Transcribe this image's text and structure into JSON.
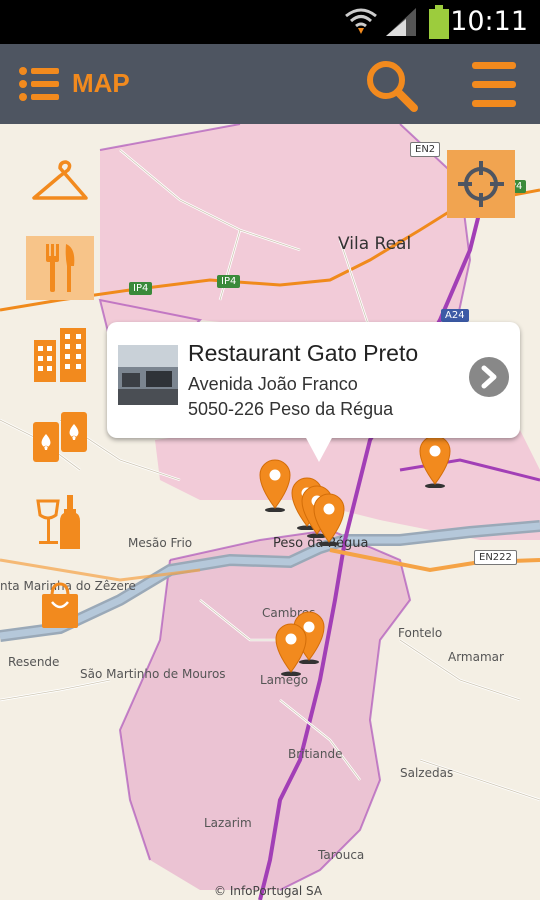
{
  "status_bar": {
    "time": "10:11"
  },
  "app_bar": {
    "title": "MAP"
  },
  "map": {
    "labels": {
      "vila_real": "Vila Real",
      "peso_da_regua": "Peso da Régua",
      "mesao_frio": "Mesão Frio",
      "santa_marinha_do_zezere": "nta Marinha do Zêzere",
      "resende": "Resende",
      "sao_martinho_de_mouros": "São Martinho de Mouros",
      "cambres": "Cambres",
      "lamego": "Lamego",
      "britiande": "Britiande",
      "salzedas": "Salzedas",
      "fontelo": "Fontelo",
      "armamar": "Armamar",
      "lazarim": "Lazarim",
      "tarouca": "Tarouca"
    },
    "roads": {
      "en2": "EN2",
      "ip4_a": "IP4",
      "ip4_b": "IP4",
      "ip4_c": "IP4",
      "a24": "A24",
      "en222": "EN222"
    },
    "copyright": "© InfoPortugal SA"
  },
  "categories": [
    {
      "icon": "hanger-icon"
    },
    {
      "icon": "fork-knife-icon",
      "active": true
    },
    {
      "icon": "building-icon"
    },
    {
      "icon": "cards-icon"
    },
    {
      "icon": "wine-icon"
    },
    {
      "icon": "shopping-bag-icon"
    }
  ],
  "popup": {
    "name": "Restaurant Gato Preto",
    "address": "Avenida João Franco",
    "postal": "5050-226 Peso da Régua"
  },
  "colors": {
    "accent": "#f28a1e",
    "appbar": "#4e5561",
    "region": "#f2c9d8",
    "border": "#a23fb6"
  }
}
